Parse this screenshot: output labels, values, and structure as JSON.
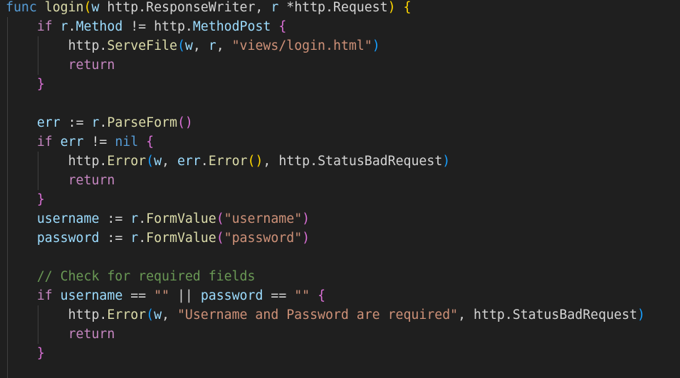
{
  "editor": {
    "lines": [
      [
        {
          "t": "func",
          "c": "kw"
        },
        {
          "t": " ",
          "c": "op"
        },
        {
          "t": "login",
          "c": "fn"
        },
        {
          "t": "(",
          "c": "br1"
        },
        {
          "t": "w",
          "c": "var"
        },
        {
          "t": " ",
          "c": "op"
        },
        {
          "t": "http.ResponseWriter",
          "c": "op"
        },
        {
          "t": ", ",
          "c": "op"
        },
        {
          "t": "r",
          "c": "var"
        },
        {
          "t": " *",
          "c": "op"
        },
        {
          "t": "http.Request",
          "c": "op"
        },
        {
          "t": ")",
          "c": "br1"
        },
        {
          "t": " ",
          "c": "op"
        },
        {
          "t": "{",
          "c": "br1"
        }
      ],
      [
        {
          "t": "    ",
          "c": "op"
        },
        {
          "t": "if",
          "c": "kw-ctrl"
        },
        {
          "t": " ",
          "c": "op"
        },
        {
          "t": "r",
          "c": "var"
        },
        {
          "t": ".",
          "c": "op"
        },
        {
          "t": "Method",
          "c": "var"
        },
        {
          "t": " != ",
          "c": "op"
        },
        {
          "t": "http",
          "c": "op"
        },
        {
          "t": ".",
          "c": "op"
        },
        {
          "t": "MethodPost",
          "c": "var"
        },
        {
          "t": " ",
          "c": "op"
        },
        {
          "t": "{",
          "c": "br2"
        }
      ],
      [
        {
          "t": "        ",
          "c": "op"
        },
        {
          "t": "http",
          "c": "op"
        },
        {
          "t": ".",
          "c": "op"
        },
        {
          "t": "ServeFile",
          "c": "fn"
        },
        {
          "t": "(",
          "c": "br3"
        },
        {
          "t": "w",
          "c": "var"
        },
        {
          "t": ", ",
          "c": "op"
        },
        {
          "t": "r",
          "c": "var"
        },
        {
          "t": ", ",
          "c": "op"
        },
        {
          "t": "\"views/login.html\"",
          "c": "str"
        },
        {
          "t": ")",
          "c": "br3"
        }
      ],
      [
        {
          "t": "        ",
          "c": "op"
        },
        {
          "t": "return",
          "c": "kw-ctrl"
        }
      ],
      [
        {
          "t": "    ",
          "c": "op"
        },
        {
          "t": "}",
          "c": "br2"
        }
      ],
      [],
      [
        {
          "t": "    ",
          "c": "op"
        },
        {
          "t": "err",
          "c": "var"
        },
        {
          "t": " := ",
          "c": "op"
        },
        {
          "t": "r",
          "c": "var"
        },
        {
          "t": ".",
          "c": "op"
        },
        {
          "t": "ParseForm",
          "c": "fn"
        },
        {
          "t": "()",
          "c": "br2"
        }
      ],
      [
        {
          "t": "    ",
          "c": "op"
        },
        {
          "t": "if",
          "c": "kw-ctrl"
        },
        {
          "t": " ",
          "c": "op"
        },
        {
          "t": "err",
          "c": "var"
        },
        {
          "t": " != ",
          "c": "op"
        },
        {
          "t": "nil",
          "c": "kw"
        },
        {
          "t": " ",
          "c": "op"
        },
        {
          "t": "{",
          "c": "br2"
        }
      ],
      [
        {
          "t": "        ",
          "c": "op"
        },
        {
          "t": "http",
          "c": "op"
        },
        {
          "t": ".",
          "c": "op"
        },
        {
          "t": "Error",
          "c": "fn"
        },
        {
          "t": "(",
          "c": "br3"
        },
        {
          "t": "w",
          "c": "var"
        },
        {
          "t": ", ",
          "c": "op"
        },
        {
          "t": "err",
          "c": "var"
        },
        {
          "t": ".",
          "c": "op"
        },
        {
          "t": "Error",
          "c": "fn"
        },
        {
          "t": "()",
          "c": "br1"
        },
        {
          "t": ", ",
          "c": "op"
        },
        {
          "t": "http",
          "c": "op"
        },
        {
          "t": ".",
          "c": "op"
        },
        {
          "t": "StatusBadRequest",
          "c": "op"
        },
        {
          "t": ")",
          "c": "br3"
        }
      ],
      [
        {
          "t": "        ",
          "c": "op"
        },
        {
          "t": "return",
          "c": "kw-ctrl"
        }
      ],
      [
        {
          "t": "    ",
          "c": "op"
        },
        {
          "t": "}",
          "c": "br2"
        }
      ],
      [
        {
          "t": "    ",
          "c": "op"
        },
        {
          "t": "username",
          "c": "var"
        },
        {
          "t": " := ",
          "c": "op"
        },
        {
          "t": "r",
          "c": "var"
        },
        {
          "t": ".",
          "c": "op"
        },
        {
          "t": "FormValue",
          "c": "fn"
        },
        {
          "t": "(",
          "c": "br2"
        },
        {
          "t": "\"username\"",
          "c": "str"
        },
        {
          "t": ")",
          "c": "br2"
        }
      ],
      [
        {
          "t": "    ",
          "c": "op"
        },
        {
          "t": "password",
          "c": "var"
        },
        {
          "t": " := ",
          "c": "op"
        },
        {
          "t": "r",
          "c": "var"
        },
        {
          "t": ".",
          "c": "op"
        },
        {
          "t": "FormValue",
          "c": "fn"
        },
        {
          "t": "(",
          "c": "br2"
        },
        {
          "t": "\"password\"",
          "c": "str"
        },
        {
          "t": ")",
          "c": "br2"
        }
      ],
      [],
      [
        {
          "t": "    ",
          "c": "op"
        },
        {
          "t": "// Check for required fields",
          "c": "cmt"
        }
      ],
      [
        {
          "t": "    ",
          "c": "op"
        },
        {
          "t": "if",
          "c": "kw-ctrl"
        },
        {
          "t": " ",
          "c": "op"
        },
        {
          "t": "username",
          "c": "var"
        },
        {
          "t": " == ",
          "c": "op"
        },
        {
          "t": "\"\"",
          "c": "str"
        },
        {
          "t": " || ",
          "c": "op"
        },
        {
          "t": "password",
          "c": "var"
        },
        {
          "t": " == ",
          "c": "op"
        },
        {
          "t": "\"\"",
          "c": "str"
        },
        {
          "t": " ",
          "c": "op"
        },
        {
          "t": "{",
          "c": "br2"
        }
      ],
      [
        {
          "t": "        ",
          "c": "op"
        },
        {
          "t": "http",
          "c": "op"
        },
        {
          "t": ".",
          "c": "op"
        },
        {
          "t": "Error",
          "c": "fn"
        },
        {
          "t": "(",
          "c": "br3"
        },
        {
          "t": "w",
          "c": "var"
        },
        {
          "t": ", ",
          "c": "op"
        },
        {
          "t": "\"Username and Password are required\"",
          "c": "str"
        },
        {
          "t": ", ",
          "c": "op"
        },
        {
          "t": "http",
          "c": "op"
        },
        {
          "t": ".",
          "c": "op"
        },
        {
          "t": "StatusBadRequest",
          "c": "op"
        },
        {
          "t": ")",
          "c": "br3"
        }
      ],
      [
        {
          "t": "        ",
          "c": "op"
        },
        {
          "t": "return",
          "c": "kw-ctrl"
        }
      ],
      [
        {
          "t": "    ",
          "c": "op"
        },
        {
          "t": "}",
          "c": "br2"
        }
      ]
    ]
  }
}
